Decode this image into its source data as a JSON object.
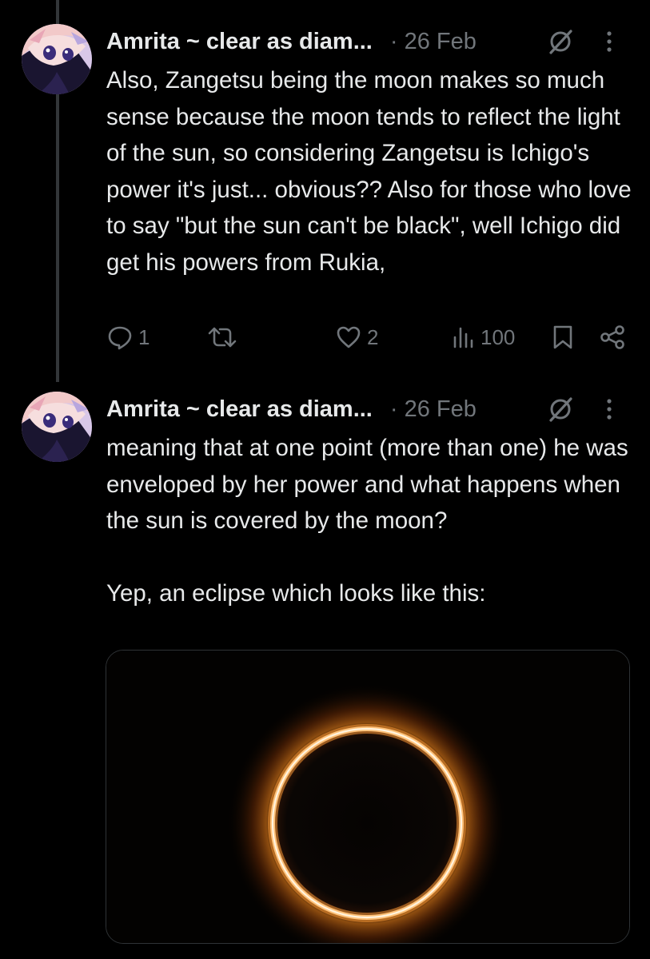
{
  "tweets": [
    {
      "author_name": "Amrita ~ clear as diam...",
      "date": "· 26 Feb",
      "text": "Also, Zangetsu being the moon makes so much sense because the moon tends to reflect the light of the sun, so considering Zangetsu is Ichigo's power it's just... obvious?? Also for those who love to say \"but the sun can't be black\", well Ichigo did get his powers from Rukia,",
      "replies": "1",
      "likes": "2",
      "views": "100",
      "icons": [
        "grok-icon",
        "more-icon",
        "reply-icon",
        "retweet-icon",
        "like-icon",
        "views-icon",
        "bookmark-icon",
        "share-icon"
      ]
    },
    {
      "author_name": "Amrita ~ clear as diam...",
      "date": "· 26 Feb",
      "text": "meaning that at one point (more than one) he was enveloped by her power and what happens when the sun is covered by the moon?\n\nYep, an eclipse which looks like this:",
      "media": "annular-eclipse-image",
      "icons": [
        "grok-icon",
        "more-icon"
      ]
    }
  ],
  "colors": {
    "background": "#000000",
    "text": "#e7e9ea",
    "secondary": "#71767b",
    "thread_line": "#333639",
    "eclipse_ring": "#ffb55a"
  }
}
